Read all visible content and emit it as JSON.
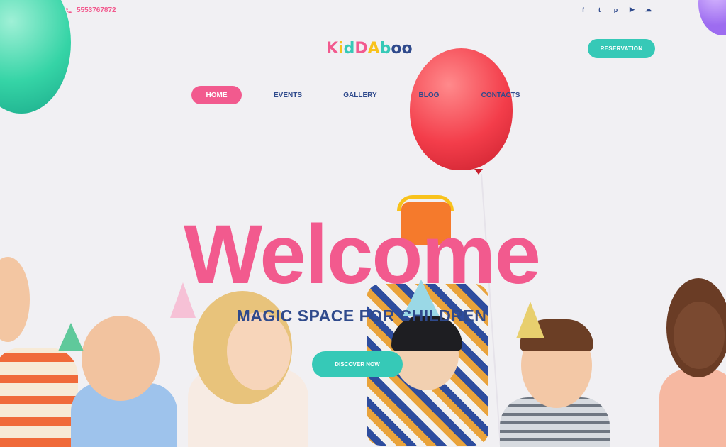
{
  "topbar": {
    "phone": "5553767872",
    "social_icons": [
      "facebook-icon",
      "twitter-icon",
      "pinterest-icon",
      "youtube-icon",
      "soundcloud-icon"
    ]
  },
  "logo": {
    "letters": [
      "K",
      "i",
      "d",
      "D",
      "A",
      "b",
      "o",
      "o"
    ],
    "colors": [
      "#f25a8e",
      "#f8c21b",
      "#36c9b7",
      "#f25a8e",
      "#f8c21b",
      "#36c9b7",
      "#2f4a8c",
      "#2f4a8c"
    ]
  },
  "header": {
    "reservation_label": "RESERVATION"
  },
  "nav": {
    "items": [
      {
        "label": "HOME"
      },
      {
        "label": "EVENTS"
      },
      {
        "label": "GALLERY"
      },
      {
        "label": "BLOG"
      },
      {
        "label": "CONTACTS"
      }
    ]
  },
  "hero": {
    "title": "Welcome",
    "subtitle": "MAGIC SPACE FOR CHILDREN",
    "cta_label": "DISCOVER NOW"
  },
  "colors": {
    "pink": "#f25a8e",
    "teal": "#36c9b7",
    "navy": "#2f4a8c",
    "background": "#f1f0f3"
  }
}
